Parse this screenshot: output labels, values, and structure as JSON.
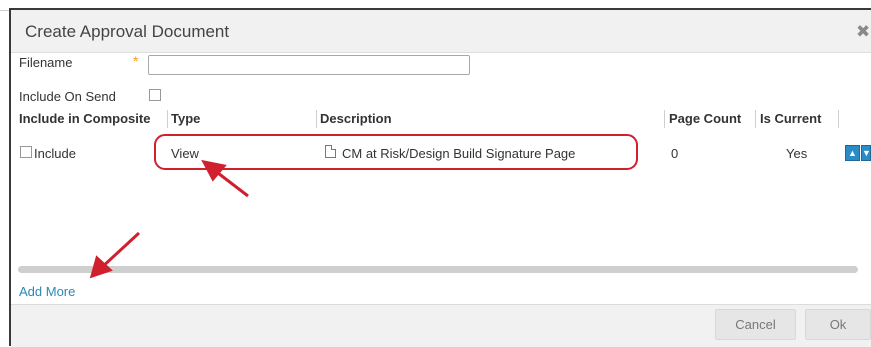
{
  "dialog": {
    "title": "Create Approval Document",
    "close_icon": "close-icon"
  },
  "form": {
    "filename_label": "Filename",
    "filename_required_mark": "*",
    "filename_value": "",
    "include_on_send_label": "Include On Send",
    "include_on_send_checked": false
  },
  "table": {
    "headers": [
      "Include in Composite",
      "Type",
      "Description",
      "Page Count",
      "Is Current"
    ],
    "rows": [
      {
        "include_label": "Include",
        "include_checked": false,
        "type": "View",
        "description": "CM at Risk/Design Build Signature Page",
        "description_icon": "document-icon",
        "page_count": "0",
        "is_current": "Yes"
      }
    ],
    "move_up_icon": "arrow-up-icon",
    "move_down_icon": "arrow-down-icon"
  },
  "add_more_label": "Add More",
  "footer": {
    "cancel_label": "Cancel",
    "ok_label": "Ok"
  },
  "colors": {
    "accent": "#2a8cc6",
    "annotation": "#d0202e",
    "required": "#f39c12"
  }
}
